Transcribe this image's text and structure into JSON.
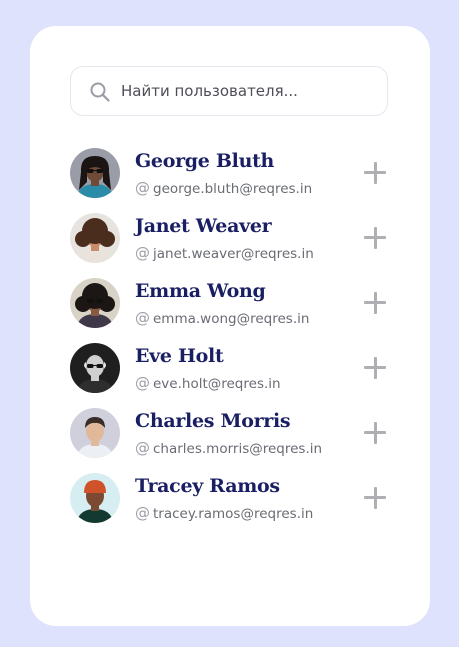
{
  "search": {
    "placeholder": "Найти пользователя...",
    "icon": "search-icon"
  },
  "users": [
    {
      "name": "George Bluth",
      "email": "george.bluth@reqres.in",
      "email_icon": "@",
      "add_icon": "plus-icon",
      "avatar": {
        "bg": "#9a9da7",
        "skin": "#6f4a36",
        "hair": "#1a1412",
        "shirt": "#2a8ca8",
        "hair_style": "long",
        "glasses": true
      }
    },
    {
      "name": "Janet Weaver",
      "email": "janet.weaver@reqres.in",
      "email_icon": "@",
      "add_icon": "plus-icon",
      "avatar": {
        "bg": "#e7e4e0",
        "skin": "#c98c68",
        "hair": "#4b2d1d",
        "shirt": "#e9e3dc",
        "hair_style": "curly",
        "glasses": false
      }
    },
    {
      "name": "Emma Wong",
      "email": "emma.wong@reqres.in",
      "email_icon": "@",
      "add_icon": "plus-icon",
      "avatar": {
        "bg": "#d9d2c6",
        "skin": "#8a5a40",
        "hair": "#1c1714",
        "shirt": "#3f3848",
        "hair_style": "curly",
        "glasses": true
      }
    },
    {
      "name": "Eve Holt",
      "email": "eve.holt@reqres.in",
      "email_icon": "@",
      "add_icon": "plus-icon",
      "avatar": {
        "bg": "#1f1f1f",
        "skin": "#cfcfcf",
        "hair": "#e7e7e7",
        "shirt": "#2e2e2e",
        "hair_style": "bald",
        "glasses": true
      }
    },
    {
      "name": "Charles Morris",
      "email": "charles.morris@reqres.in",
      "email_icon": "@",
      "add_icon": "plus-icon",
      "avatar": {
        "bg": "#cfd0db",
        "skin": "#e2b89b",
        "hair": "#3a2d27",
        "shirt": "#eceff3",
        "hair_style": "short",
        "glasses": false
      }
    },
    {
      "name": "Tracey Ramos",
      "email": "tracey.ramos@reqres.in",
      "email_icon": "@",
      "add_icon": "plus-icon",
      "avatar": {
        "bg": "#d6eef2",
        "skin": "#7a4a32",
        "hair": "#d0522a",
        "shirt": "#123a30",
        "hair_style": "beanie",
        "glasses": false
      }
    }
  ],
  "colors": {
    "background": "#dfe2fd",
    "card": "#ffffff",
    "name": "#1a1f63",
    "email": "#6a6c74",
    "icon_gray": "#aeaeb3"
  }
}
